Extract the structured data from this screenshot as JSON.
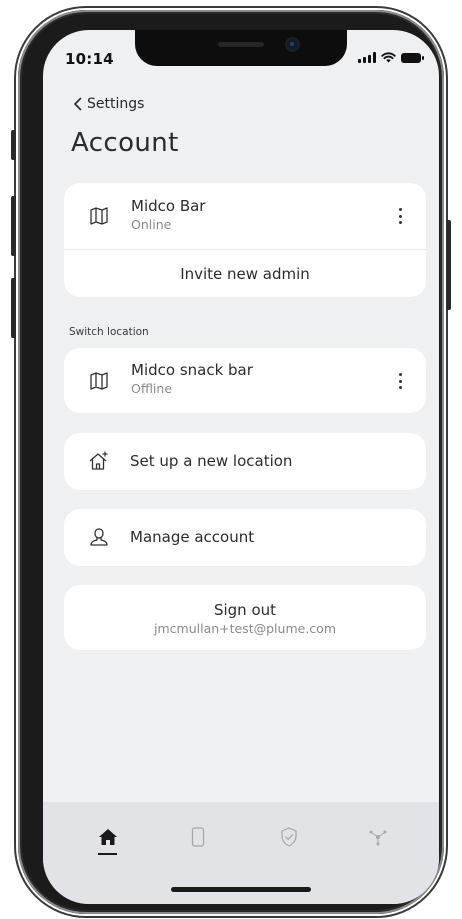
{
  "status_bar": {
    "time": "10:14"
  },
  "nav": {
    "back_label": "Settings",
    "title": "Account"
  },
  "current_location": {
    "name": "Midco Bar",
    "status": "Online",
    "invite_label": "Invite new admin"
  },
  "switch_location": {
    "section_label": "Switch location",
    "items": [
      {
        "name": "Midco snack bar",
        "status": "Offline"
      }
    ]
  },
  "actions": {
    "setup_location_label": "Set up a new location",
    "manage_account_label": "Manage account",
    "sign_out_label": "Sign out",
    "email": "jmcmullan+test@plume.com"
  },
  "tabbar": {
    "tabs": [
      {
        "icon": "home-icon",
        "active": true
      },
      {
        "icon": "device-icon",
        "active": false
      },
      {
        "icon": "shield-icon",
        "active": false
      },
      {
        "icon": "network-icon",
        "active": false
      }
    ]
  },
  "colors": {
    "background": "#eef0f2",
    "card": "#ffffff",
    "tabbar": "#e1e3e6",
    "text": "#2c2c2c",
    "muted": "#8a8a8a"
  }
}
